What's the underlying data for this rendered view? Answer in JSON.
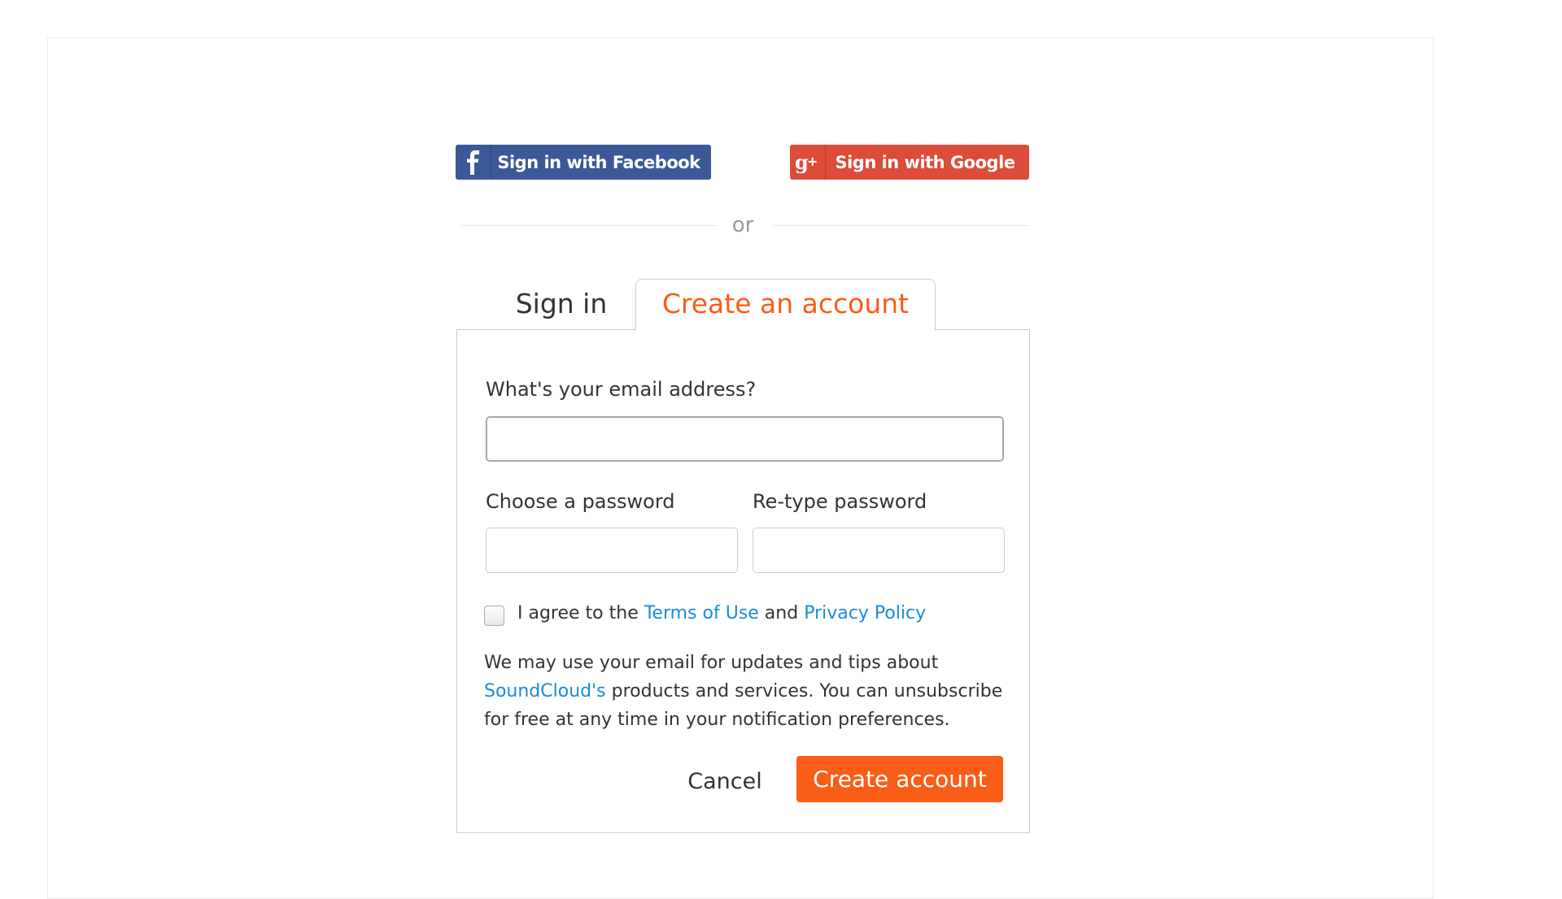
{
  "social": {
    "facebook_label": "Sign in with Facebook",
    "facebook_icon": "facebook-f-icon",
    "facebook_color": "#3b5998",
    "google_label": "Sign in with Google",
    "google_icon": "google-plus-icon",
    "google_color": "#dd4b39"
  },
  "divider": {
    "text": "or"
  },
  "tabs": [
    {
      "label": "Sign in",
      "active": false
    },
    {
      "label": "Create an account",
      "active": true
    }
  ],
  "form": {
    "email_label": "What's your email address?",
    "email_value": "",
    "password_label": "Choose a password",
    "password_value": "",
    "retype_label": "Re-type password",
    "retype_value": "",
    "agree": {
      "checked": false,
      "prefix": "I agree to the ",
      "terms_link": "Terms of Use",
      "middle": " and ",
      "privacy_link": "Privacy Policy"
    },
    "notice": {
      "prefix": "We may use your email for updates and tips about ",
      "brand_link": "SoundCloud's",
      "suffix": " products and services. You can unsubscribe for free at any time in your notification preferences."
    },
    "cancel_label": "Cancel",
    "submit_label": "Create account"
  },
  "colors": {
    "accent": "#f95d17",
    "link": "#1a8bd8"
  }
}
